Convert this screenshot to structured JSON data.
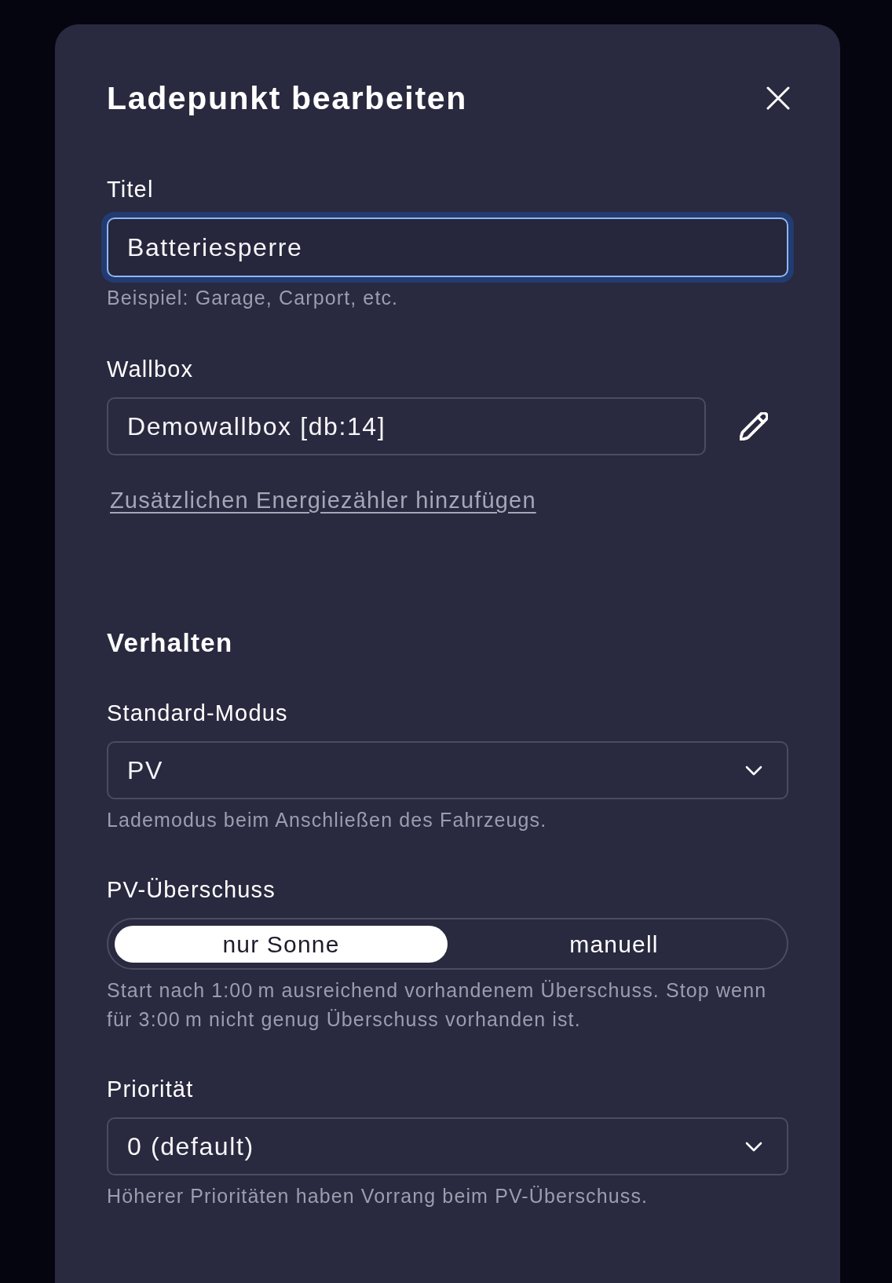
{
  "dialog": {
    "title": "Ladepunkt bearbeiten"
  },
  "general": [
    {
      "kind": "text",
      "label": "Titel",
      "value": "Batteriesperre",
      "focused": true,
      "hint": "Beispiel: Garage, Carport, etc."
    },
    {
      "kind": "device",
      "label": "Wallbox",
      "value": "Demowallbox [db:14]",
      "link": "Zusätzlichen Energiezähler hinzufügen"
    }
  ],
  "behavior": {
    "title": "Verhalten",
    "fields": [
      {
        "kind": "select",
        "label": "Standard-Modus",
        "value": "PV",
        "hint": "Lademodus beim Anschließen des Fahrzeugs."
      },
      {
        "kind": "segmented",
        "label": "PV-Überschuss",
        "options": [
          {
            "label": "nur Sonne",
            "selected": true
          },
          {
            "label": "manuell",
            "selected": false
          }
        ],
        "hint": "Start nach 1:00 m ausreichend vorhandenem Überschuss. Stop wenn für 3:00 m nicht genug Überschuss vorhanden ist."
      },
      {
        "kind": "select",
        "label": "Priorität",
        "value": "0 (default)",
        "hint": "Höherer Prioritäten haben Vorrang beim PV-Überschuss."
      }
    ]
  }
}
